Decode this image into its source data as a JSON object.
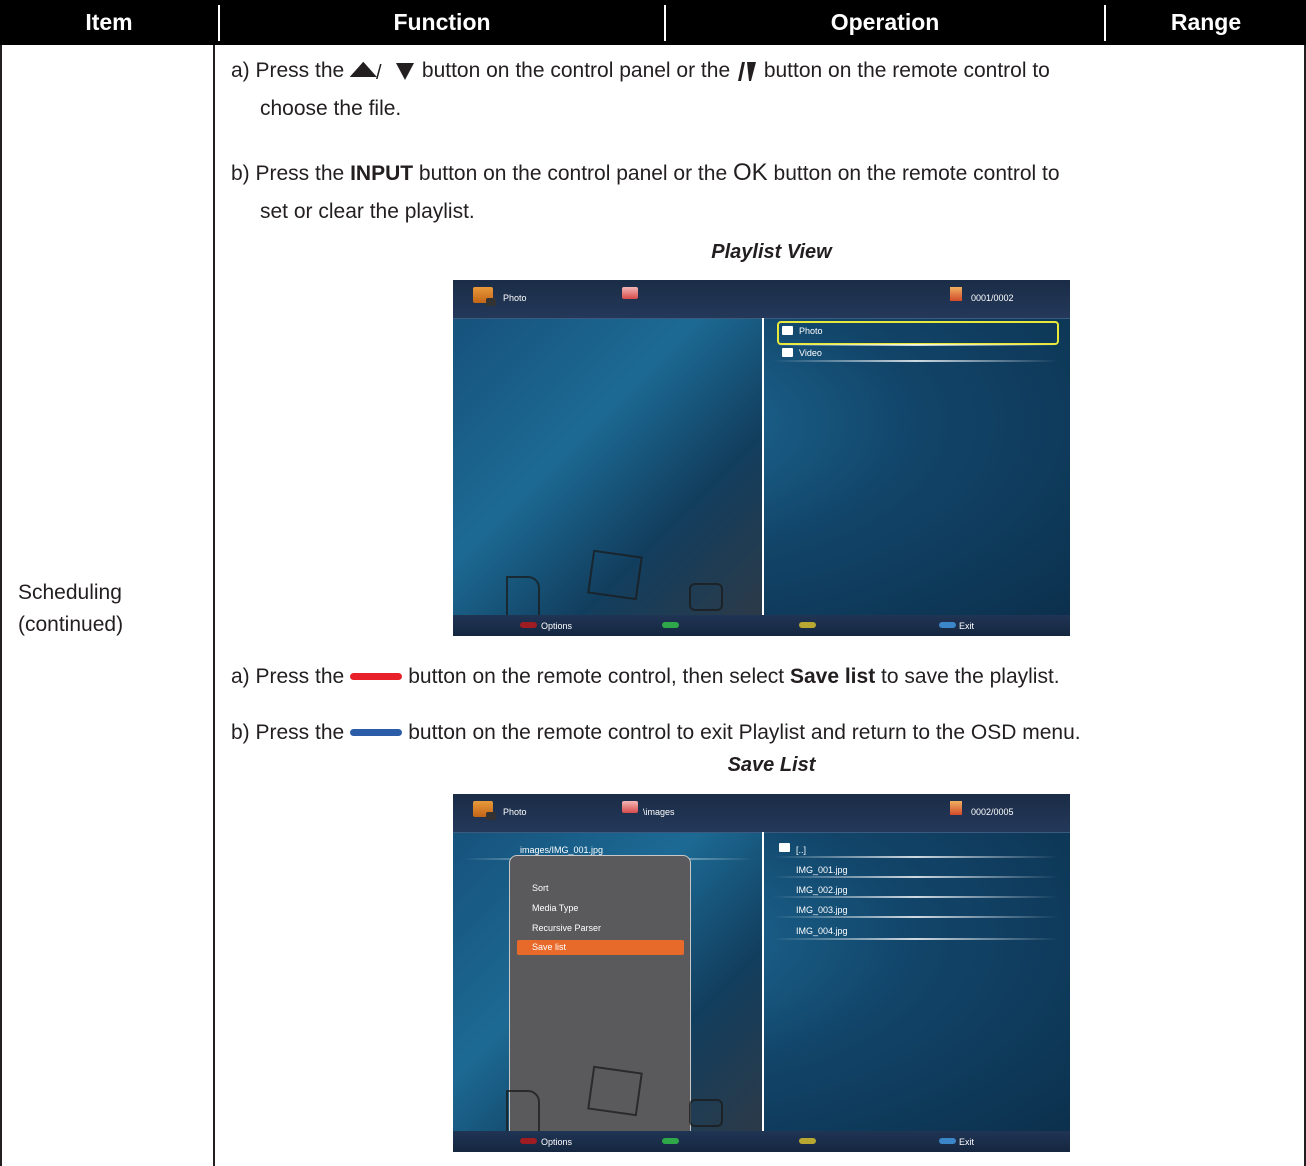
{
  "header": {
    "item": "Item",
    "function": "Function",
    "operation": "Operation",
    "range": "Range"
  },
  "item_cell": {
    "line1": "Scheduling",
    "line2": "(continued)"
  },
  "steps": {
    "a1_pre": "a) Press the",
    "a1_mid": "button on the control panel or the",
    "a1_post": "button on the remote control to",
    "a1_cont": "choose the file.",
    "b1_pre": "b) Press the",
    "b1_bold": "INPUT",
    "b1_mid": "button on the control panel or the",
    "b1_ok": "OK",
    "b1_post": "button on the remote control to",
    "b1_cont": "set or clear the playlist.",
    "a2_pre": "a) Press the",
    "a2_mid": "button on the remote control, then select",
    "a2_bold": "Save list",
    "a2_post": "to save the playlist.",
    "b2_pre": "b) Press the",
    "b2_post": "button on the remote control to exit Playlist and return to the OSD menu."
  },
  "colors": {
    "red_button": "#e8202a",
    "blue_button": "#2b5ca8",
    "highlight": "#e86a2a",
    "select_border": "#e8e83a"
  },
  "screen1": {
    "caption": "Playlist View",
    "top_label": "Photo",
    "counter": "0001/0002",
    "items": [
      "Photo",
      "Video"
    ],
    "footer": {
      "options": "Options",
      "exit": "Exit"
    }
  },
  "screen2": {
    "caption": "Save List",
    "top_label": "Photo",
    "path": "\\images",
    "counter": "0002/0005",
    "current_file": "images/IMG_001.jpg",
    "menu": [
      "Sort",
      "Media Type",
      "Recursive Parser",
      "Save list"
    ],
    "files": [
      "[..]",
      "IMG_001.jpg",
      "IMG_002.jpg",
      "IMG_003.jpg",
      "IMG_004.jpg"
    ],
    "footer": {
      "options": "Options",
      "exit": "Exit"
    }
  }
}
